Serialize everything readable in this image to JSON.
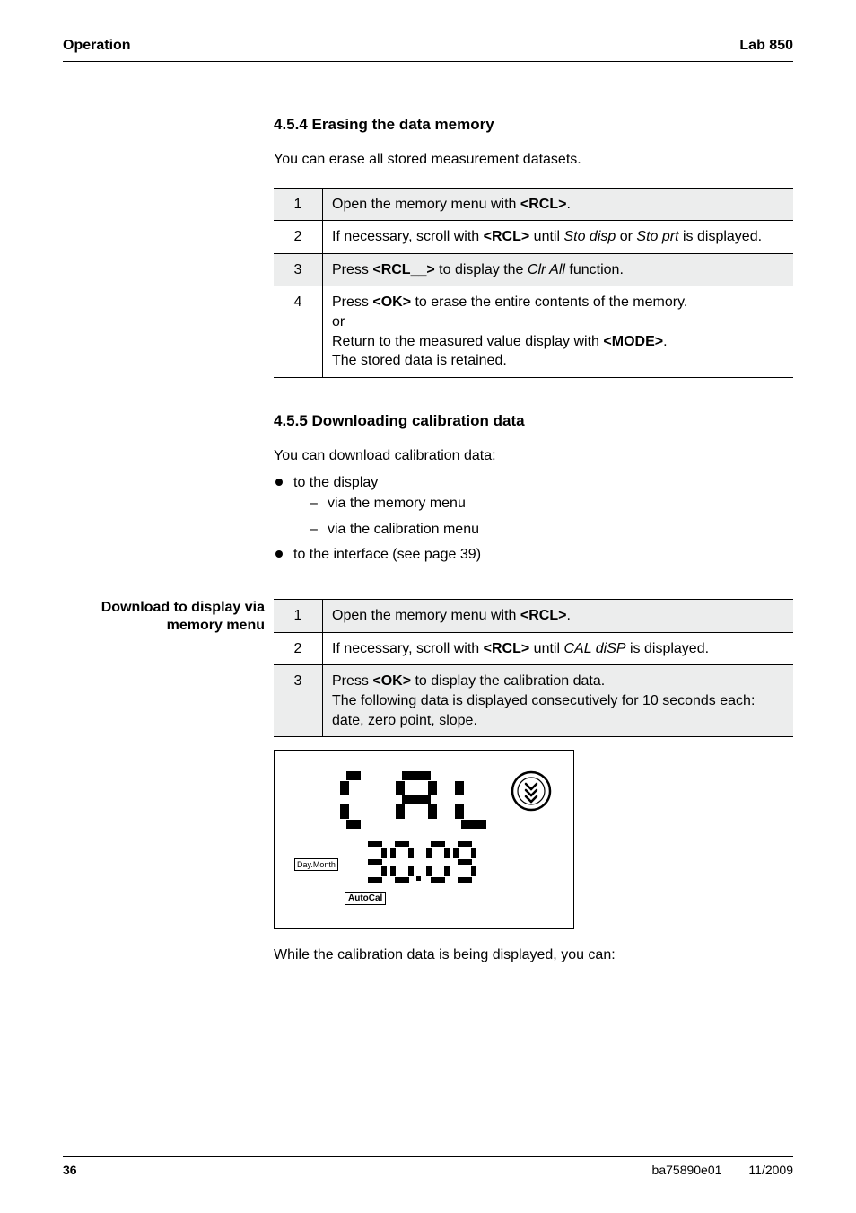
{
  "header": {
    "left": "Operation",
    "right": "Lab 850"
  },
  "sec454": {
    "heading": "4.5.4   Erasing the data memory",
    "intro": "You can erase all stored measurement datasets.",
    "steps": [
      {
        "n": "1",
        "html": "Open the memory menu with <b>&lt;RCL&gt;</b>."
      },
      {
        "n": "2",
        "html": "If necessary, scroll with <b>&lt;RCL&gt;</b> until <i>Sto disp</i> or <i>Sto prt</i> is displayed."
      },
      {
        "n": "3",
        "html": "Press <b>&lt;RCL<span class=\"sp\">__</span>&gt;</b> to display the <i>Clr All</i>  function."
      },
      {
        "n": "4",
        "html": "Press <b>&lt;OK&gt;</b> to erase the entire contents of the memory.<br>or<br>Return to the measured value display with <b>&lt;MODE&gt;</b>.<br>The stored data is retained."
      }
    ]
  },
  "sec455": {
    "heading": "4.5.5   Downloading calibration data",
    "intro": "You can download calibration data:",
    "bullets": [
      {
        "text": "to the display",
        "sub": [
          "via the memory menu",
          "via the calibration menu"
        ]
      },
      {
        "text": "to the interface (see page 39)"
      }
    ]
  },
  "download": {
    "sidebar1": "Download to display via",
    "sidebar2": "memory menu",
    "steps": [
      {
        "n": "1",
        "html": "Open the memory menu with <b>&lt;RCL&gt;</b>."
      },
      {
        "n": "2",
        "html": "If necessary, scroll with <b>&lt;RCL&gt;</b> until <i>CAL diSP</i> is displayed."
      },
      {
        "n": "3",
        "html": "Press <b>&lt;OK&gt;</b> to display the calibration data.<br>The following data is displayed consecutively for 10 seconds each:<br>date, zero point, slope."
      }
    ],
    "lcd": {
      "dayMonth": "Day.Month",
      "autoCal": "AutoCal"
    },
    "after": "While the calibration data is being displayed, you can:"
  },
  "footer": {
    "pageNum": "36",
    "docId": "ba75890e01",
    "date": "11/2009"
  }
}
